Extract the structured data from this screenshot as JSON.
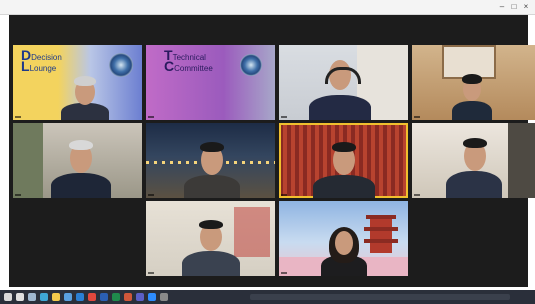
{
  "window": {
    "title": ""
  },
  "participants": [
    {
      "id": "decision-lounge",
      "name": "",
      "slide_title_line1": "Decision",
      "slide_title_line2": "Lounge"
    },
    {
      "id": "technical-committee",
      "name": "",
      "slide_title_line1": "Technical",
      "slide_title_line2": "Committee"
    },
    {
      "id": "p3",
      "name": ""
    },
    {
      "id": "p4",
      "name": ""
    },
    {
      "id": "p5",
      "name": ""
    },
    {
      "id": "p6",
      "name": ""
    },
    {
      "id": "p7",
      "name": ""
    },
    {
      "id": "p8",
      "name": ""
    },
    {
      "id": "p9",
      "name": ""
    },
    {
      "id": "p10",
      "name": ""
    }
  ],
  "taskbar": {
    "icons": [
      "start-icon",
      "search-icon",
      "task-view-icon",
      "edge-icon",
      "folder-icon",
      "store-icon",
      "mail-icon",
      "chrome-icon",
      "word-icon",
      "excel-icon",
      "powerpoint-icon",
      "teams-icon",
      "zoom-icon",
      "settings-icon"
    ]
  },
  "colors": {
    "active_speaker": "#f0c02e",
    "grid_background": "#1c1c1c"
  }
}
